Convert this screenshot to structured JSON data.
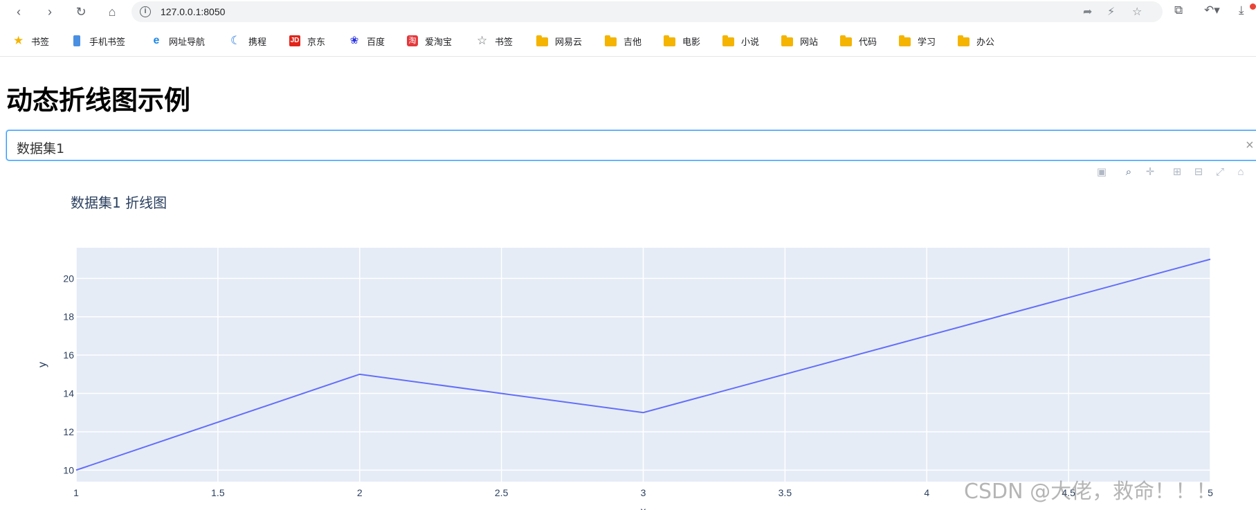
{
  "browser": {
    "url": "127.0.0.1:8050",
    "bookmarks": [
      {
        "label": "书签",
        "icon": "star-filled-icon"
      },
      {
        "label": "手机书签",
        "icon": "mobile-icon"
      },
      {
        "label": "网址导航",
        "icon": "ie-icon"
      },
      {
        "label": "携程",
        "icon": "ctrip-icon"
      },
      {
        "label": "京东",
        "icon": "jd-icon",
        "icon_text": "JD"
      },
      {
        "label": "百度",
        "icon": "baidu-paw-icon"
      },
      {
        "label": "爱淘宝",
        "icon": "taobao-icon",
        "icon_text": "淘"
      },
      {
        "label": "书签",
        "icon": "star-outline-icon"
      },
      {
        "label": "网易云",
        "icon": "folder-icon"
      },
      {
        "label": "吉他",
        "icon": "folder-icon"
      },
      {
        "label": "电影",
        "icon": "folder-icon"
      },
      {
        "label": "小说",
        "icon": "folder-icon"
      },
      {
        "label": "网站",
        "icon": "folder-icon"
      },
      {
        "label": "代码",
        "icon": "folder-icon"
      },
      {
        "label": "学习",
        "icon": "folder-icon"
      },
      {
        "label": "办公",
        "icon": "folder-icon"
      }
    ]
  },
  "page": {
    "title": "动态折线图示例",
    "dropdown": {
      "selected": "数据集1",
      "clear_glyph": "×"
    }
  },
  "chart_data": {
    "type": "line",
    "title": "数据集1 折线图",
    "xlabel": "x",
    "ylabel": "y",
    "x": [
      1,
      2,
      3,
      4,
      5
    ],
    "y": [
      10,
      15,
      13,
      17,
      21
    ],
    "xlim": [
      1,
      5
    ],
    "ylim": [
      9.4,
      21.6
    ],
    "x_ticks": [
      "1",
      "1.5",
      "2",
      "2.5",
      "3",
      "3.5",
      "4",
      "4.5",
      "5"
    ],
    "y_ticks": [
      "10",
      "12",
      "14",
      "16",
      "18",
      "20"
    ],
    "line_color": "#636efa",
    "plot_background": "#e5ecf6",
    "grid": true
  },
  "watermark": "CSDN @大佬，救命！！！"
}
